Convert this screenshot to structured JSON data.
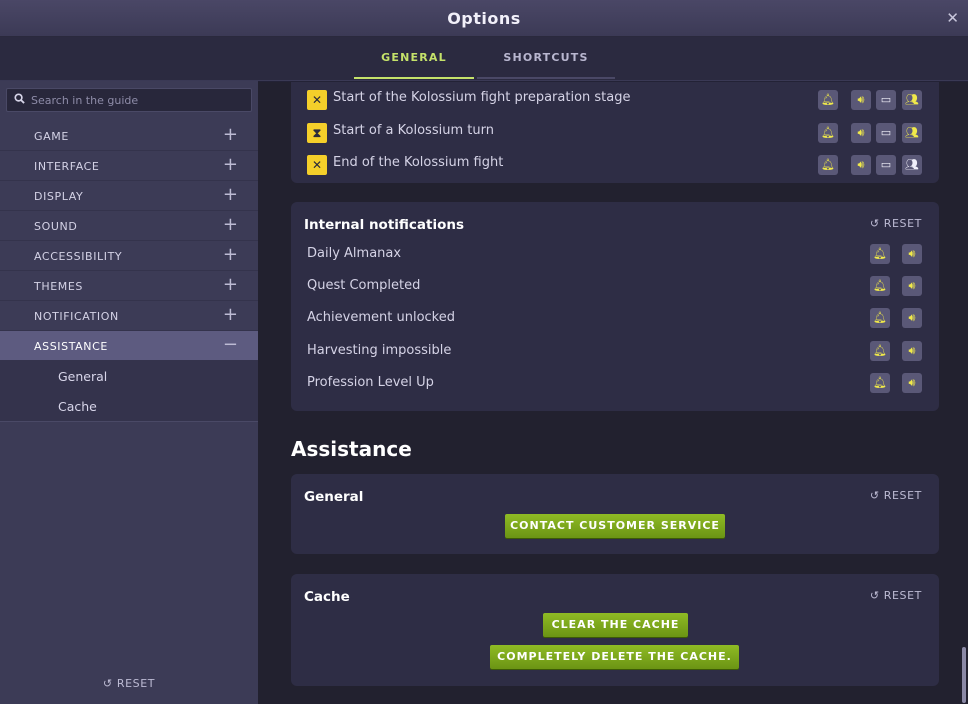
{
  "window": {
    "title": "Options",
    "close_symbol": "✕"
  },
  "tabs": [
    {
      "label": "GENERAL",
      "active": true
    },
    {
      "label": "SHORTCUTS",
      "active": false
    }
  ],
  "sidebar": {
    "search_placeholder": "Search in the guide",
    "items": [
      {
        "label": "GAME",
        "symbol": "+"
      },
      {
        "label": "INTERFACE",
        "symbol": "+"
      },
      {
        "label": "DISPLAY",
        "symbol": "+"
      },
      {
        "label": "SOUND",
        "symbol": "+"
      },
      {
        "label": "ACCESSIBILITY",
        "symbol": "+"
      },
      {
        "label": "THEMES",
        "symbol": "+"
      },
      {
        "label": "NOTIFICATION",
        "symbol": "+"
      },
      {
        "label": "ASSISTANCE",
        "symbol": "−"
      }
    ],
    "subitems": [
      {
        "label": "General"
      },
      {
        "label": "Cache"
      }
    ],
    "reset_label": "RESET"
  },
  "kolossium_notifications": [
    {
      "label": "Start of the Kolossium fight preparation stage",
      "icon": "crossed-swords-icon"
    },
    {
      "label": "Start of a Kolossium turn",
      "icon": "hourglass-icon"
    },
    {
      "label": "End of the Kolossium fight",
      "icon": "crossed-swords-icon"
    }
  ],
  "internal_notifications": {
    "title": "Internal notifications",
    "reset_label": "RESET",
    "items": [
      {
        "label": "Daily Almanax"
      },
      {
        "label": "Quest Completed"
      },
      {
        "label": "Achievement unlocked"
      },
      {
        "label": "Harvesting impossible"
      },
      {
        "label": "Profession Level Up"
      }
    ]
  },
  "assistance": {
    "title": "Assistance",
    "general": {
      "title": "General",
      "reset_label": "RESET",
      "contact_button": "CONTACT CUSTOMER SERVICE"
    },
    "cache": {
      "title": "Cache",
      "reset_label": "RESET",
      "clear_button": "CLEAR THE CACHE",
      "delete_button": "COMPLETELY DELETE THE CACHE."
    }
  },
  "colors": {
    "accent": "#c5e26a",
    "button_green": "#7ea51c",
    "icon_yellow": "#f4cf2a"
  }
}
